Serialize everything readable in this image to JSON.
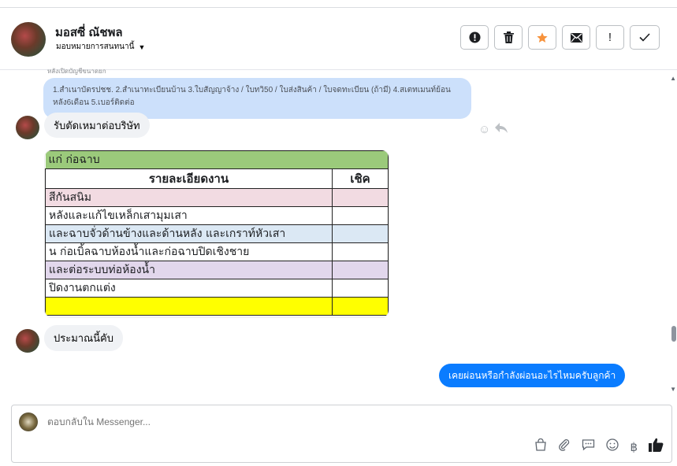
{
  "header": {
    "contact_name": "มอสซี่ ณัชพล",
    "assign_label": "มอบหมายการสนทนานี้",
    "actions": [
      {
        "name": "spam-alert-button",
        "glyph": "❗"
      },
      {
        "name": "delete-button",
        "glyph": "🗑"
      },
      {
        "name": "star-button",
        "glyph": "★",
        "color": "#f7923b"
      },
      {
        "name": "mail-button",
        "glyph": "✉"
      },
      {
        "name": "follow-up-button",
        "glyph": "!"
      },
      {
        "name": "done-button",
        "glyph": "✓"
      }
    ]
  },
  "messages": {
    "cut_text": "หลังเปิดบัญชีขนาดยก",
    "doc_list": "1.สำเนาบัตรปชช. 2.สำเนาทะเบียนบ้าน 3.ใบสัญญาจ้าง / ใบทวิ50 / ใบส่งสินค้า / ใบจดทะเบียน (ถ้ามี) 4.สเตทเมนท์ย้อนหลัง6เดือน 5.เบอร์ติดต่อ",
    "msg1": "รับตัดเหมาต่อบริษัท",
    "msg2": "ประมาณนี้คับ",
    "outgoing": "เคยผ่อนหรือกำลังผ่อนอะไรไหมครับลูกค้า"
  },
  "sheet": {
    "title_row": "แก่ ก่อฉาบ",
    "header_left": "รายละเอียดงาน",
    "header_right": "เชิค",
    "rows": [
      {
        "text": "สีกันสนิม",
        "color": "#f2dbe2"
      },
      {
        "text": "หลังและแก้ไขเหล็กเสามุมเสา",
        "color": "#ffffff"
      },
      {
        "text": " และฉาบจั่วด้านข้างและด้านหลัง และเกราท์หัวเสา",
        "color": "#dbe8f4"
      },
      {
        "text": "น ก่อเบิ้ลฉาบห้องน้ำและก่อฉาบปิดเชิงชาย",
        "color": "#ffffff"
      },
      {
        "text": "และต่อระบบท่อห้องน้ำ",
        "color": "#e2d7ec"
      },
      {
        "text": "ปิดงานตกแต่ง",
        "color": "#ffffff"
      },
      {
        "text": "",
        "color": "#ffff00"
      }
    ],
    "title_color": "#9bca7b"
  },
  "composer": {
    "placeholder": "ตอบกลับใน Messenger..."
  },
  "tools": [
    "bag-icon",
    "attachment-icon",
    "saved-reply-icon",
    "emoji-icon",
    "baht-icon",
    "like-icon"
  ]
}
